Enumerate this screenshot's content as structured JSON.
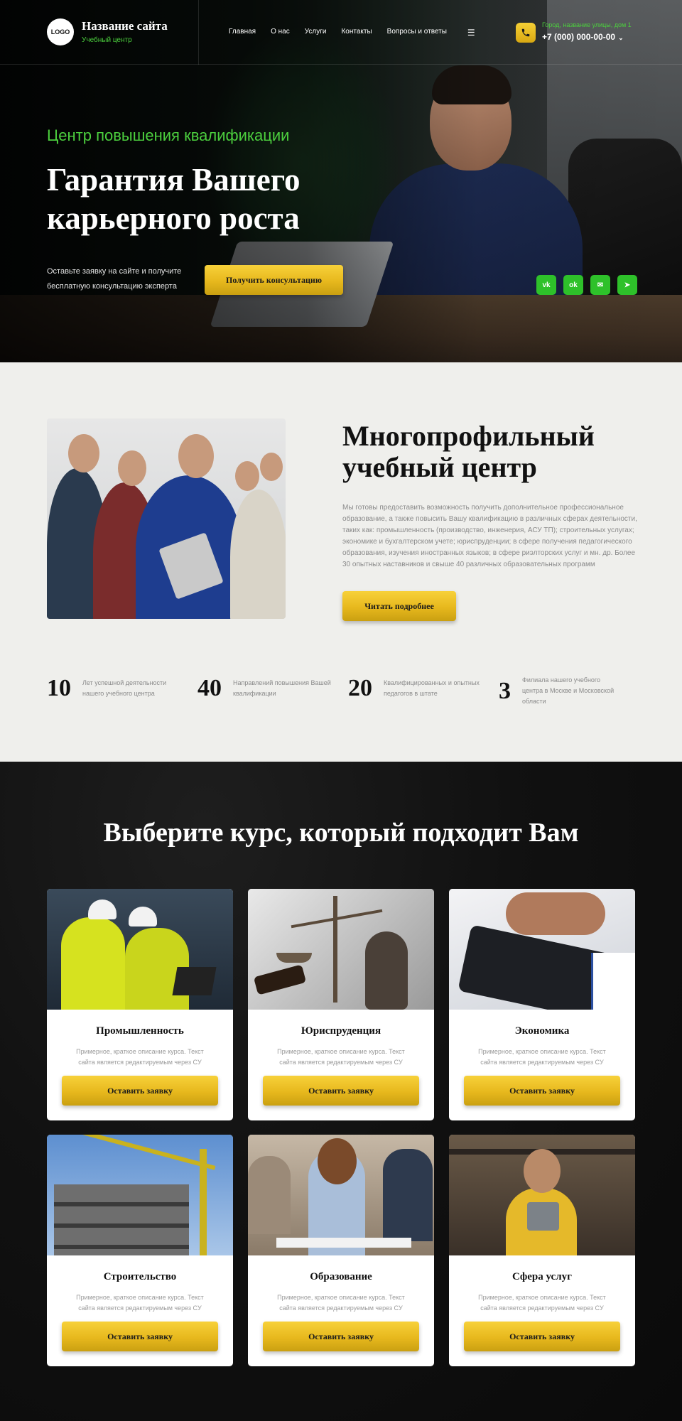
{
  "header": {
    "logo_text": "LOGO",
    "site_name": "Название сайта",
    "site_subtitle": "Учебный центр",
    "nav": [
      "Главная",
      "О нас",
      "Услуги",
      "Контакты",
      "Вопросы и ответы"
    ],
    "menu_icon": "☰",
    "address": "Город, название улицы, дом 1",
    "phone": "+7 (000) 000-00-00",
    "phone_chevron": "⌄"
  },
  "hero": {
    "kicker": "Центр повышения квалификации",
    "title": "Гарантия Вашего карьерного роста",
    "text": "Оставьте заявку на сайте и получите бесплатную консультацию эксперта",
    "button": "Получить консультацию",
    "socials": [
      {
        "icon": "vk-icon",
        "glyph": "vk"
      },
      {
        "icon": "ok-icon",
        "glyph": "ok"
      },
      {
        "icon": "mail-icon",
        "glyph": "✉"
      },
      {
        "icon": "telegram-icon",
        "glyph": "➤"
      }
    ]
  },
  "about": {
    "title": "Многопрофильный учебный центр",
    "text": "Мы готовы предоставить возможность получить дополнительное профессиональное образование, а также повысить Вашу квалификацию в различных сферах деятельности, таких как: промышленность (производство, инженерия, АСУ ТП); строительных услугах; экономике и бухгалтерском учете; юриспруденции; в сфере получения педагогического образования, изучения иностранных языков; в сфере риэлторских услуг и мн. др. Более 30 опытных наставников и свыше 40 различных образовательных программ",
    "button": "Читать подробнее",
    "stats": [
      {
        "number": "10",
        "label": "Лет успешной деятельности нашего учебного центра"
      },
      {
        "number": "40",
        "label": "Направлений повышения Вашей квалификации"
      },
      {
        "number": "20",
        "label": "Квалифицированных и опытных педагогов в штате"
      },
      {
        "number": "3",
        "label": "Филиала нашего учебного центра в Москве и Московской области"
      }
    ]
  },
  "courses": {
    "title": "Выберите курс, который подходит Вам",
    "button": "Оставить заявку",
    "items": [
      {
        "title": "Промышленность",
        "desc": "Примерное, краткое описание курса. Текст сайта является редактируемым через CУ"
      },
      {
        "title": "Юриспруденция",
        "desc": "Примерное, краткое описание курса. Текст сайта является редактируемым через CУ"
      },
      {
        "title": "Экономика",
        "desc": "Примерное, краткое описание курса. Текст сайта является редактируемым через CУ"
      },
      {
        "title": "Строительство",
        "desc": "Примерное, краткое описание курса. Текст сайта является редактируемым через CУ"
      },
      {
        "title": "Образование",
        "desc": "Примерное, краткое описание курса. Текст сайта является редактируемым через CУ"
      },
      {
        "title": "Сфера услуг",
        "desc": "Примерное, краткое описание курса. Текст сайта является редактируемым через CУ"
      }
    ]
  },
  "colors": {
    "accent_green": "#4ccf3e",
    "gold": "#e7b81d",
    "social_green": "#2ec12a",
    "light_bg": "#efefec",
    "dark_bg": "#111111"
  }
}
